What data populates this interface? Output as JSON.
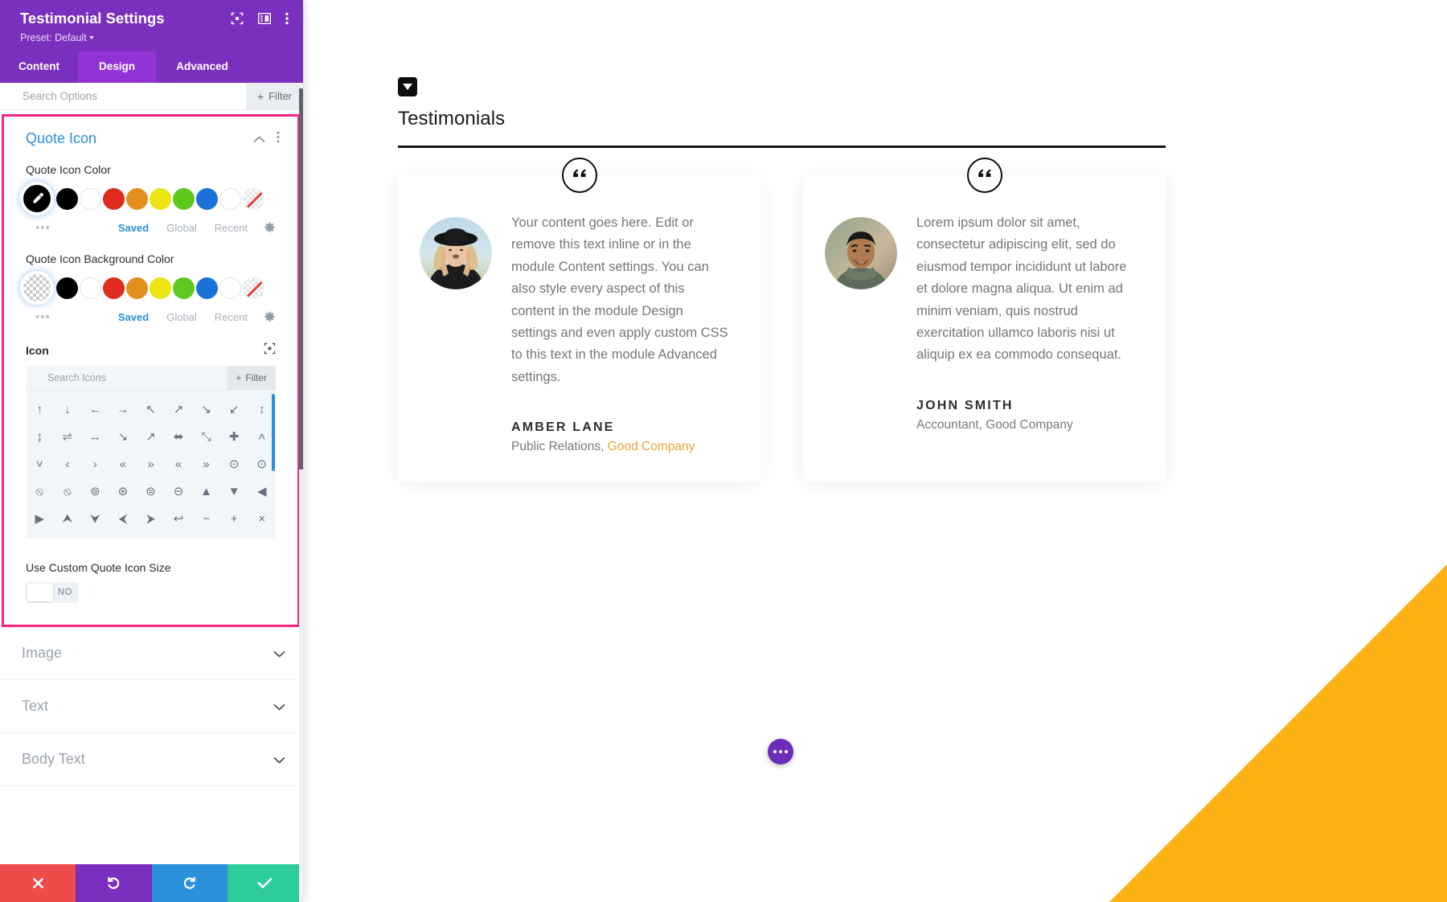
{
  "panel": {
    "title": "Testimonial Settings",
    "preset_label": "Preset: Default",
    "header_icons": [
      {
        "name": "fullscreen-icon"
      },
      {
        "name": "layout-columns-icon"
      },
      {
        "name": "kebab-menu-icon"
      }
    ],
    "tabs": [
      {
        "label": "Content",
        "active": false
      },
      {
        "label": "Design",
        "active": true
      },
      {
        "label": "Advanced",
        "active": false
      }
    ],
    "search": {
      "placeholder": "Search Options",
      "filter_label": "Filter"
    },
    "section": {
      "title": "Quote Icon",
      "collapse_icon": "chevron-up-icon",
      "menu_icon": "kebab-menu-icon"
    },
    "quote_icon_color": {
      "label": "Quote Icon Color",
      "selected": "#000000",
      "swatches": [
        "#000000",
        "#ffffff",
        "#E02B20",
        "#E2901B",
        "#EDE511",
        "#5DC91E",
        "#1C71D8",
        "#ffffff",
        "none"
      ],
      "more_dots": "•••",
      "tabs": [
        {
          "label": "Saved",
          "active": true
        },
        {
          "label": "Global",
          "active": false
        },
        {
          "label": "Recent",
          "active": false
        }
      ],
      "settings_icon": "gear-icon"
    },
    "quote_icon_bg_color": {
      "label": "Quote Icon Background Color",
      "selected": "transparent",
      "swatches": [
        "#000000",
        "#ffffff",
        "#E02B20",
        "#E2901B",
        "#EDE511",
        "#5DC91E",
        "#1C71D8",
        "#ffffff",
        "none"
      ],
      "more_dots": "•••",
      "tabs": [
        {
          "label": "Saved",
          "active": true
        },
        {
          "label": "Global",
          "active": false
        },
        {
          "label": "Recent",
          "active": false
        }
      ],
      "settings_icon": "gear-icon"
    },
    "icon_field": {
      "label": "Icon",
      "reset_icon": "target-icon",
      "search_placeholder": "Search Icons",
      "filter_label": "Filter",
      "glyphs": [
        "↑",
        "↓",
        "←",
        "→",
        "↖",
        "↗",
        "↘",
        "↙",
        "↕",
        "↨",
        "⇌",
        "↔",
        "↘",
        "↗",
        "⬌",
        "⤡",
        "✚",
        "˄",
        "˅",
        "‹",
        "›",
        "«",
        "»",
        "«",
        "»",
        "⊙",
        "⊙",
        "⦸",
        "⦸",
        "⊚",
        "⊛",
        "⊜",
        "⊝",
        "▲",
        "▼",
        "◀",
        "▶",
        "⮝",
        "⮟",
        "⮜",
        "⮞",
        "↩",
        "−",
        "+",
        "×"
      ]
    },
    "custom_size": {
      "label": "Use Custom Quote Icon Size",
      "toggle_value": "NO"
    },
    "accordions": [
      {
        "label": "Image",
        "chevron": "chevron-down-icon"
      },
      {
        "label": "Text",
        "chevron": "chevron-down-icon"
      },
      {
        "label": "Body Text",
        "chevron": "chevron-down-icon"
      }
    ],
    "actions": [
      {
        "name": "cancel-button",
        "glyph": "✖",
        "color": "#EE4B4B"
      },
      {
        "name": "undo-button",
        "glyph": "↺",
        "color": "#7B2FBE"
      },
      {
        "name": "redo-button",
        "glyph": "↻",
        "color": "#2A90D9"
      },
      {
        "name": "save-button",
        "glyph": "✔",
        "color": "#2ECC9B"
      }
    ]
  },
  "canvas": {
    "section_handle_icon": "section-toggle-icon",
    "page_title": "Testimonials",
    "accent_corner_color": "#FBB114",
    "fab_icon": "more-options-icon",
    "testimonials": [
      {
        "quote_icon": "quote-marks-icon",
        "avatar": "woman-in-hat-photo",
        "quote": "Your content goes here. Edit or remove this text inline or in the module Content settings. You can also style every aspect of this content in the module Design settings and even apply custom CSS to this text in the module Advanced settings.",
        "author": "AMBER LANE",
        "role_prefix": "Public Relations, ",
        "company": "Good Company",
        "company_is_link": true
      },
      {
        "quote_icon": "quote-marks-icon",
        "avatar": "smiling-man-photo",
        "quote": "Lorem ipsum dolor sit amet, consectetur adipiscing elit, sed do eiusmod tempor incididunt ut labore et dolore magna aliqua. Ut enim ad minim veniam, quis nostrud exercitation ullamco laboris nisi ut aliquip ex ea commodo consequat.",
        "author": "JOHN SMITH",
        "role_prefix": "Accountant, ",
        "company": "Good Company",
        "company_is_link": false
      }
    ]
  }
}
